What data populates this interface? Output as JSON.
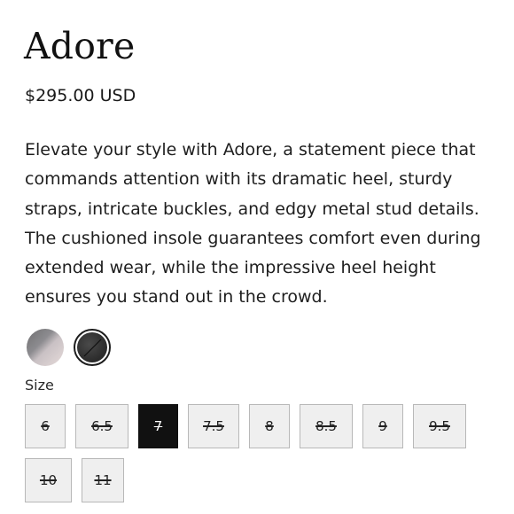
{
  "product": {
    "title": "Adore",
    "price": "$295.00 USD",
    "description": "Elevate your style with Adore, a statement piece that commands attention with its dramatic heel, sturdy straps, intricate buckles, and edgy metal stud details. The cushioned insole guarantees comfort even during extended wear, while the impressive heel height ensures you stand out in the crowd."
  },
  "swatches": [
    {
      "name": "light-grey-pink",
      "selected": false
    },
    {
      "name": "charcoal",
      "selected": true,
      "unavailable": true
    }
  ],
  "size_selector": {
    "label": "Size",
    "options": [
      {
        "label": "6",
        "unavailable": true
      },
      {
        "label": "6.5",
        "unavailable": true
      },
      {
        "label": "7",
        "selected": true,
        "unavailable": true
      },
      {
        "label": "7.5",
        "unavailable": true
      },
      {
        "label": "8",
        "unavailable": true
      },
      {
        "label": "8.5",
        "unavailable": true
      },
      {
        "label": "9",
        "unavailable": true
      },
      {
        "label": "9.5",
        "unavailable": true
      },
      {
        "label": "10",
        "unavailable": true
      },
      {
        "label": "11",
        "unavailable": true
      }
    ]
  },
  "colors": {
    "selected_bg": "#111111",
    "option_bg": "#efefef",
    "option_border": "#b8b8b8"
  }
}
